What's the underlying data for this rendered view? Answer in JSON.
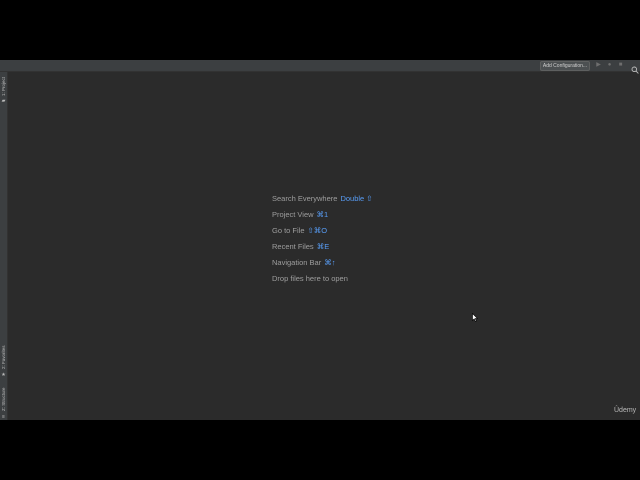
{
  "toolbar": {
    "add_configuration_label": "Add Configuration...",
    "icons": [
      "run-icon",
      "debug-icon",
      "stop-icon",
      "search-icon"
    ]
  },
  "sidebar": {
    "top_tab_label": "1: Project",
    "favorites_tab_label": "2: Favorites",
    "structure_tab_label": "Z: Structure"
  },
  "welcome_hints": [
    {
      "label": "Search Everywhere",
      "shortcut": "Double ⇧"
    },
    {
      "label": "Project View",
      "shortcut": "⌘1"
    },
    {
      "label": "Go to File",
      "shortcut": "⇧⌘O"
    },
    {
      "label": "Recent Files",
      "shortcut": "⌘E"
    },
    {
      "label": "Navigation Bar",
      "shortcut": "⌘↑"
    }
  ],
  "drop_files_text": "Drop files here to open",
  "watermark": "Ûdemy",
  "colors": {
    "editor_background": "#2b2b2b",
    "hint_text": "#9e9e9e",
    "shortcut_accent": "#589df6",
    "panel_background": "#3c3f41"
  }
}
